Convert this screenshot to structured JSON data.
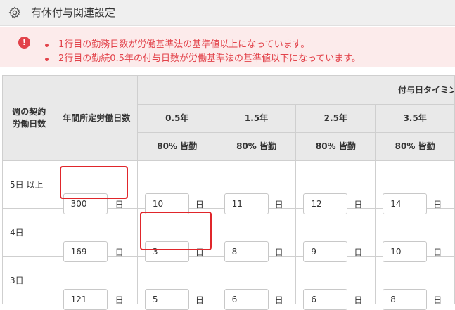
{
  "header": {
    "title": "有休付与関連設定",
    "icon": "gear-icon"
  },
  "alert": {
    "icon": "exclamation-circle-icon",
    "color": "#e2424a",
    "messages": [
      "1行目の勤務日数が労働基準法の基準値以上になっています。",
      "2行目の勤続0.5年の付与日数が労働基準法の基準値以下になっています。"
    ]
  },
  "table": {
    "col_weekly": "週の契約\n労働日数",
    "col_annual": "年間所定労働日数",
    "group_label": "付与日タイミング",
    "periods": [
      {
        "label": "0.5年",
        "attendance": "80% 皆勤"
      },
      {
        "label": "1.5年",
        "attendance": "80% 皆勤"
      },
      {
        "label": "2.5年",
        "attendance": "80% 皆勤"
      },
      {
        "label": "3.5年",
        "attendance": "80% 皆勤"
      }
    ],
    "unit": "日",
    "rows": [
      {
        "label": "5日 以上",
        "annual": "300",
        "grants": [
          "10",
          "11",
          "12",
          "14"
        ]
      },
      {
        "label": "4日",
        "annual": "169",
        "grants": [
          "3",
          "8",
          "9",
          "10"
        ]
      },
      {
        "label": "3日",
        "annual": "121",
        "grants": [
          "5",
          "6",
          "6",
          "8"
        ]
      }
    ]
  },
  "error_highlight_color": "#e0262b"
}
